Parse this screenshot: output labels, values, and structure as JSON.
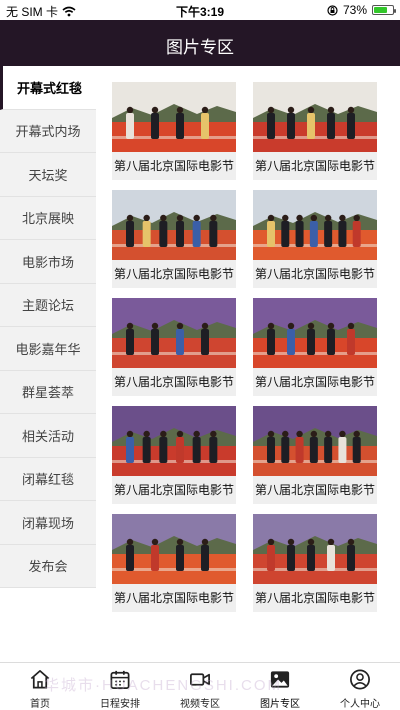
{
  "status_bar": {
    "carrier": "无 SIM 卡",
    "time": "下午3:19",
    "battery": "73%",
    "battery_level": 0.73
  },
  "header": {
    "title": "图片专区"
  },
  "sidebar": {
    "items": [
      {
        "label": "开幕式红毯",
        "active": true
      },
      {
        "label": "开幕式内场"
      },
      {
        "label": "天坛奖"
      },
      {
        "label": "北京展映"
      },
      {
        "label": "电影市场"
      },
      {
        "label": "主题论坛"
      },
      {
        "label": "电影嘉年华"
      },
      {
        "label": "群星荟萃"
      },
      {
        "label": "相关活动"
      },
      {
        "label": "闭幕红毯"
      },
      {
        "label": "闭幕现场"
      },
      {
        "label": "发布会"
      }
    ]
  },
  "gallery": {
    "cards": [
      {
        "caption": "第八届北京国际电影节"
      },
      {
        "caption": "第八届北京国际电影节"
      },
      {
        "caption": "第八届北京国际电影节"
      },
      {
        "caption": "第八届北京国际电影节"
      },
      {
        "caption": "第八届北京国际电影节"
      },
      {
        "caption": "第八届北京国际电影节"
      },
      {
        "caption": "第八届北京国际电影节"
      },
      {
        "caption": "第八届北京国际电影节"
      },
      {
        "caption": "第八届北京国际电影节"
      },
      {
        "caption": "第八届北京国际电影节"
      }
    ]
  },
  "tab_bar": {
    "tabs": [
      {
        "label": "首页",
        "icon": "home-icon"
      },
      {
        "label": "日程安排",
        "icon": "calendar-icon"
      },
      {
        "label": "视频专区",
        "icon": "video-icon"
      },
      {
        "label": "图片专区",
        "icon": "picture-icon",
        "active": true
      },
      {
        "label": "个人中心",
        "icon": "user-icon"
      }
    ]
  },
  "watermark": "华城市·HUACHENGSHI.COM",
  "colors": {
    "header_bg": "#241626",
    "carpet": "#d8462a",
    "sidebar_bg": "#f2f2f2"
  }
}
